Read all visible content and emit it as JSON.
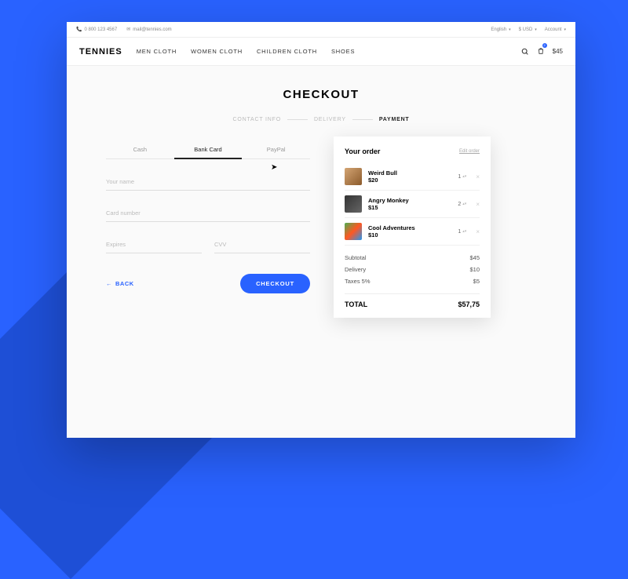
{
  "topbar": {
    "phone": "0 800 123 4567",
    "email": "mail@tennies.com",
    "lang": "English",
    "currency": "$ USD",
    "account": "Account"
  },
  "nav": {
    "logo": "TENNIES",
    "links": [
      "MEN CLOTH",
      "WOMEN CLOTH",
      "CHILDREN CLOTH",
      "SHOES"
    ],
    "cart_count": "2",
    "cart_amount": "$45"
  },
  "page": {
    "title": "CHECKOUT"
  },
  "steps": [
    "CONTACT INFO",
    "DELIVERY",
    "PAYMENT"
  ],
  "tabs": [
    "Cash",
    "Bank Card",
    "PayPal"
  ],
  "form": {
    "name_ph": "Your name",
    "card_ph": "Card number",
    "exp_ph": "Expires",
    "cvv_ph": "CVV",
    "back": "BACK",
    "checkout": "CHECKOUT"
  },
  "order": {
    "title": "Your order",
    "edit": "Edit order",
    "items": [
      {
        "name": "Weird Bull",
        "price": "$20",
        "qty": "1"
      },
      {
        "name": "Angry Monkey",
        "price": "$15",
        "qty": "2"
      },
      {
        "name": "Cool Adventures",
        "price": "$10",
        "qty": "1"
      }
    ],
    "subtotal_l": "Subtotal",
    "subtotal_v": "$45",
    "delivery_l": "Delivery",
    "delivery_v": "$10",
    "taxes_l": "Taxes 5%",
    "taxes_v": "$5",
    "total_l": "TOTAL",
    "total_v": "$57,75"
  }
}
